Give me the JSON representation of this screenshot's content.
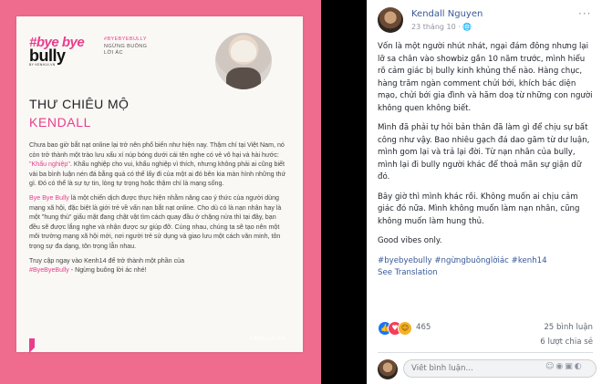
{
  "image": {
    "logo": {
      "line1": "#bye bye",
      "line2": "bully",
      "sub": "BY KENH14.VN"
    },
    "tagline": {
      "hashtag": "#BYEBYEBULLY",
      "line2": "NGỪNG BUÔNG",
      "line3": "LỜI ÁC"
    },
    "title": "THƯ CHIÊU MỘ",
    "name": "KENDALL",
    "p1_a": "Chưa bao giờ bắt nạt online lại trở nên phổ biến như hiện nay. Thậm chí tại Việt Nam, nó còn trở thành một trào lưu xấu xí núp bóng dưới cái tên nghe có vẻ vô hại và hài hước: ",
    "p1_highlight": "\"Khẩu nghiệp\"",
    "p1_b": ". Khẩu nghiệp cho vui, khẩu nghiệp vì thích, nhưng không phải ai cũng biết vài ba bình luận nén đá bằng quả có thể lấy đi của một ai đó bên kia màn hình những thứ gì. Đó có thể là sự tự tin, lòng tự trọng hoặc thậm chí là mạng sống.",
    "p2_highlight": "Bye Bye Bully",
    "p2_b": " là một chiến dịch được thực hiện nhằm nâng cao ý thức của người dùng mạng xã hội, đặc biệt là giới trẻ về vấn nạn bắt nạt online. Cho dù có là nạn nhân hay là một \"hung thủ\" giấu mặt đang chật vật tìm cách quay đầu ở chặng nửa thì tại đây, bạn đều sẽ được lắng nghe và nhận được sự giúp đỡ. Cùng nhau, chúng ta sẽ tạo nên một môi trường mạng xã hội mới, nơi người trẻ sử dụng và giao lưu một cách văn minh, tôn trọng sự đa dạng, tôn trọng lẫn nhau.",
    "p3_a": "Truy cập ngay vào Kenh14 để trở thành một phần của",
    "p3_highlight": "#ByeByeBully",
    "p3_b": " - Ngừng buông lời ác nhé!",
    "site": "KENH14.VN"
  },
  "post": {
    "author": "Kendall Nguyen",
    "date": "23 tháng 10 · ",
    "privacy_icon": "globe-icon",
    "more_label": "···",
    "paragraphs": [
      "Vốn là một người nhút nhát, ngại đám đông nhưng lại lỡ sa chân vào showbiz gần 10 năm trước, mình hiểu rõ cảm giác bị bully kinh khủng thế nào. Hàng chục, hàng trăm ngàn comment chửi bới, khích bác diện mạo, chửi bới gia đình và hăm doạ từ những con người không quen không biết.",
      "Mình đã phải tự hỏi bản thân đã làm gì để chịu sự bất công như vậy. Bao nhiêu gạch đá dao găm từ dư luận, mình gom lại và trả lại đời. Từ nạn nhân của bully, mình lại đi bully người khác để thoả mãn sự giận dữ đó.",
      "Bây giờ thì mình khác rồi. Không muốn ai chịu cảm giác đó nữa. Mình không muốn làm nạn nhân, cũng không muốn làm hung thủ.",
      "Good vibes only."
    ],
    "hashtags": "#byebyebully #ngừngbuônglờiác #kenh14",
    "see_translation": "See Translation",
    "reaction_count": "465",
    "comments": "25 bình luận",
    "shares": "6 lượt chia sẻ",
    "comment_placeholder": "Viết bình luận..."
  }
}
